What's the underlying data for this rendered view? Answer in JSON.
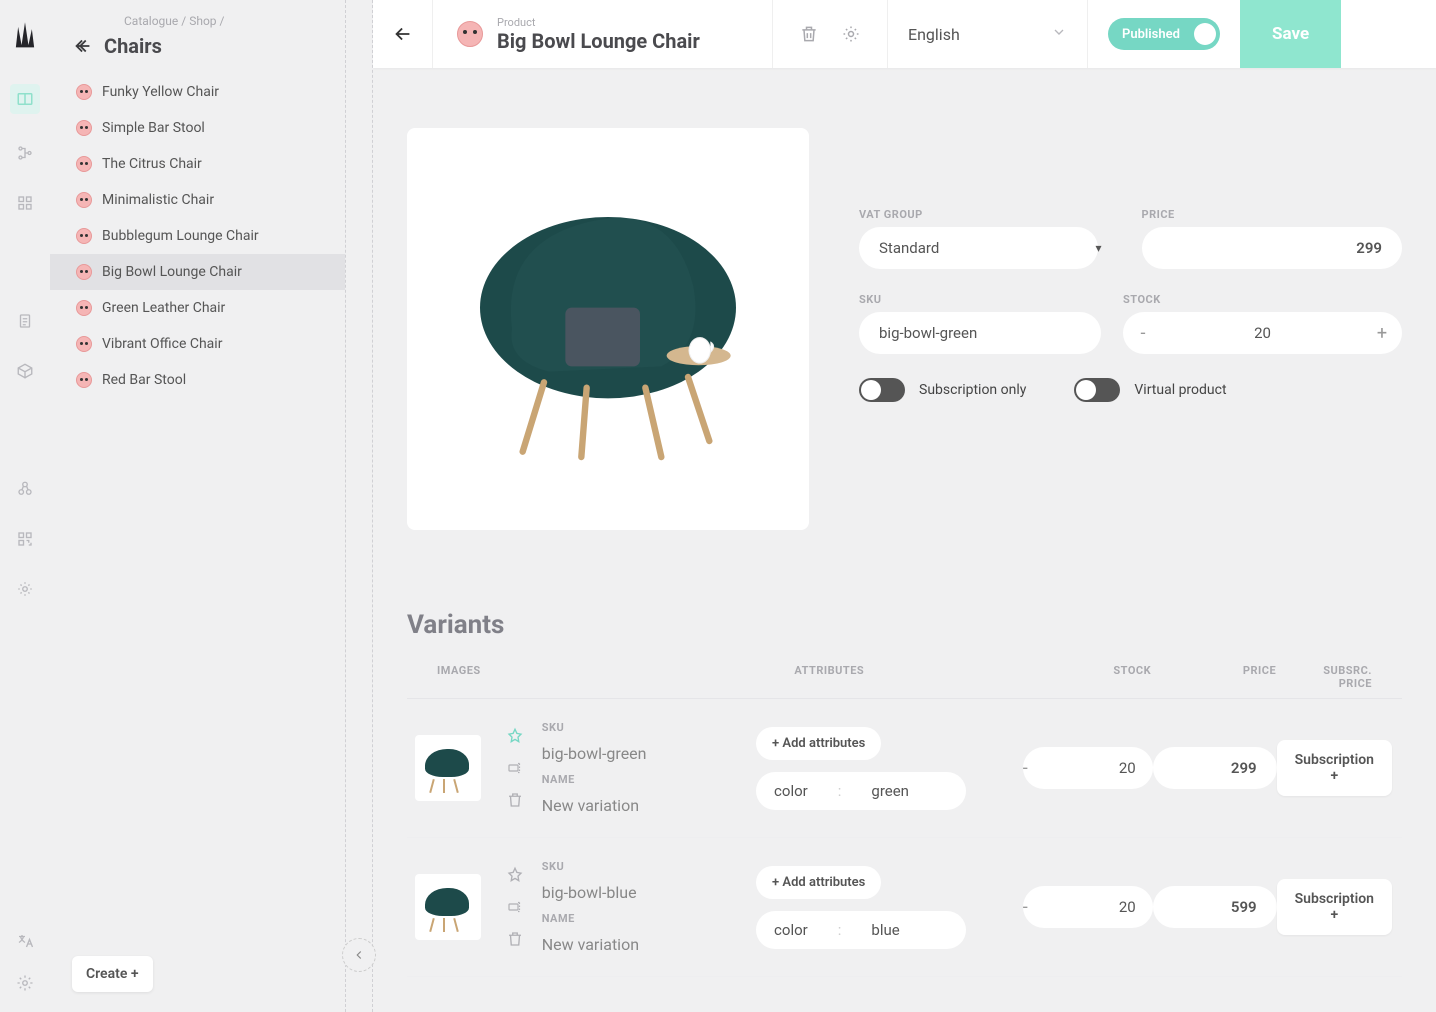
{
  "breadcrumb": {
    "a": "Catalogue",
    "b": "Shop"
  },
  "sidebar": {
    "title": "Chairs",
    "items": [
      {
        "label": "Funky Yellow Chair"
      },
      {
        "label": "Simple Bar Stool"
      },
      {
        "label": "The Citrus Chair"
      },
      {
        "label": "Minimalistic Chair"
      },
      {
        "label": "Bubblegum Lounge Chair"
      },
      {
        "label": "Big Bowl Lounge Chair"
      },
      {
        "label": "Green Leather Chair"
      },
      {
        "label": "Vibrant Office Chair"
      },
      {
        "label": "Red Bar Stool"
      }
    ],
    "create_label": "Create +"
  },
  "header": {
    "type_label": "Product",
    "name": "Big Bowl Lounge Chair",
    "language": "English",
    "published_label": "Published",
    "save_label": "Save"
  },
  "fields": {
    "vat_label": "VAT GROUP",
    "vat_value": "Standard",
    "price_label": "PRICE",
    "price_value": "299",
    "sku_label": "SKU",
    "sku_value": "big-bowl-green",
    "stock_label": "STOCK",
    "stock_value": "20",
    "sub_only_label": "Subscription only",
    "virtual_label": "Virtual product"
  },
  "variants": {
    "title": "Variants",
    "headers": {
      "images": "IMAGES",
      "sku": "",
      "attributes": "ATTRIBUTES",
      "stock": "STOCK",
      "price": "PRICE",
      "sub": "SUBSRC. PRICE"
    },
    "add_attr_label": "+ Add attributes",
    "sub_btn_label": "Subscription +",
    "sku_label": "SKU",
    "name_label": "NAME",
    "rows": [
      {
        "sku": "big-bowl-green",
        "name": "New variation",
        "attr_key": "color",
        "attr_val": "green",
        "stock": "20",
        "price": "299",
        "starred": true
      },
      {
        "sku": "big-bowl-blue",
        "name": "New variation",
        "attr_key": "color",
        "attr_val": "blue",
        "stock": "20",
        "price": "599",
        "starred": false
      }
    ]
  }
}
